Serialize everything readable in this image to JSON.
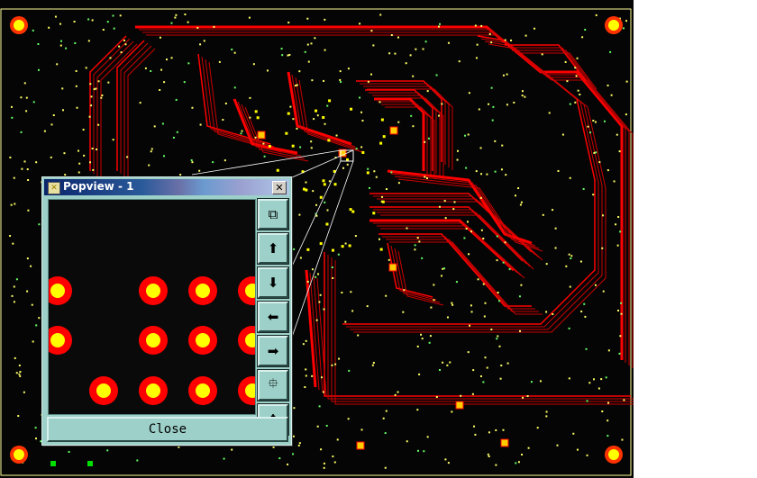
{
  "popview": {
    "title": "Popview - 1",
    "close_label": "Close",
    "tools": [
      {
        "name": "zoom-window-icon",
        "glyph": "⧉"
      },
      {
        "name": "pan-up-icon",
        "glyph": "⬆"
      },
      {
        "name": "pan-down-icon",
        "glyph": "⬇"
      },
      {
        "name": "pan-left-icon",
        "glyph": "⬅"
      },
      {
        "name": "pan-right-icon",
        "glyph": "➡"
      },
      {
        "name": "zoom-in-icon",
        "glyph": "⯐"
      },
      {
        "name": "zoom-out-icon",
        "glyph": "✥"
      }
    ]
  },
  "colors": {
    "board": "#050505",
    "trace": "#ff0000",
    "pad": "#ffff00",
    "panel": "#9cd0c8"
  }
}
